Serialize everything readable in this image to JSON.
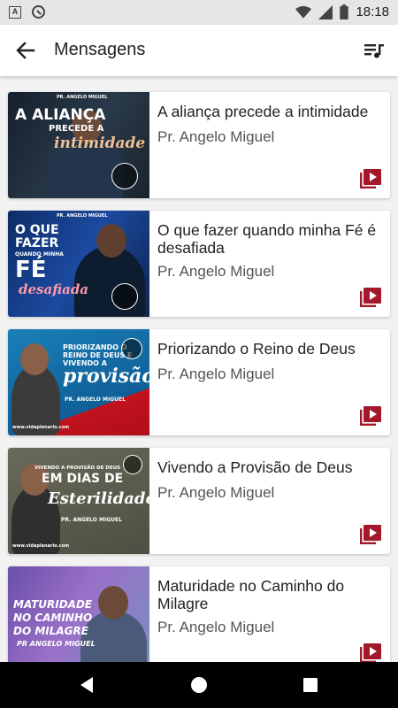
{
  "status_bar": {
    "time": "18:18"
  },
  "app_bar": {
    "title": "Mensagens"
  },
  "messages": [
    {
      "title": "A aliança precede a intimidade",
      "speaker": "Pr. Angelo Miguel",
      "thumb": {
        "pastor": "PR. ANGELO MIGUEL",
        "line1": "A ALIANÇA",
        "line2": "PRECEDE A",
        "line3": "intimidade"
      }
    },
    {
      "title": "O que fazer quando minha Fé é desafiada",
      "speaker": "Pr. Angelo Miguel",
      "thumb": {
        "pastor": "PR. ANGELO MIGUEL",
        "line1": "O QUE",
        "line2": "FAZER",
        "line3": "QUANDO",
        "line4": "MINHA",
        "line5": "FÉ",
        "line6": "desafiada"
      }
    },
    {
      "title": "Priorizando o Reino de Deus",
      "speaker": "Pr. Angelo Miguel",
      "thumb": {
        "line1": "PRIORIZANDO O",
        "line2": "REINO DE DEUS E",
        "line3": "VIVENDO A",
        "line4": "provisão",
        "pastor": "PR. ANGELO MIGUEL",
        "site": "www.vidaplenario.com"
      }
    },
    {
      "title": "Vivendo a Provisão de Deus",
      "speaker": "Pr. Angelo Miguel",
      "thumb": {
        "line1": "VIVENDO A PROVISÃO DE DEUS",
        "line2": "EM DIAS DE",
        "line3": "Esterilidade",
        "pastor": "PR. ANGELO MIGUEL",
        "site": "www.vidaplenario.com"
      }
    },
    {
      "title": "Maturidade no Caminho do Milagre",
      "speaker": "Pr. Angelo Miguel",
      "thumb": {
        "line1": "MATURIDADE",
        "line2": "NO CAMINHO",
        "line3": "DO MILAGRE",
        "pastor": "PR ANGELO MIGUEL"
      }
    }
  ],
  "icons": {
    "back": "arrow-left-icon",
    "queue": "queue-music-icon",
    "play": "video-library-icon",
    "nav_back": "triangle-back-icon",
    "nav_home": "circle-home-icon",
    "nav_recent": "square-recent-icon"
  },
  "colors": {
    "accent": "#a3182b",
    "app_bar": "#ffffff",
    "background": "#f2f2f2"
  }
}
